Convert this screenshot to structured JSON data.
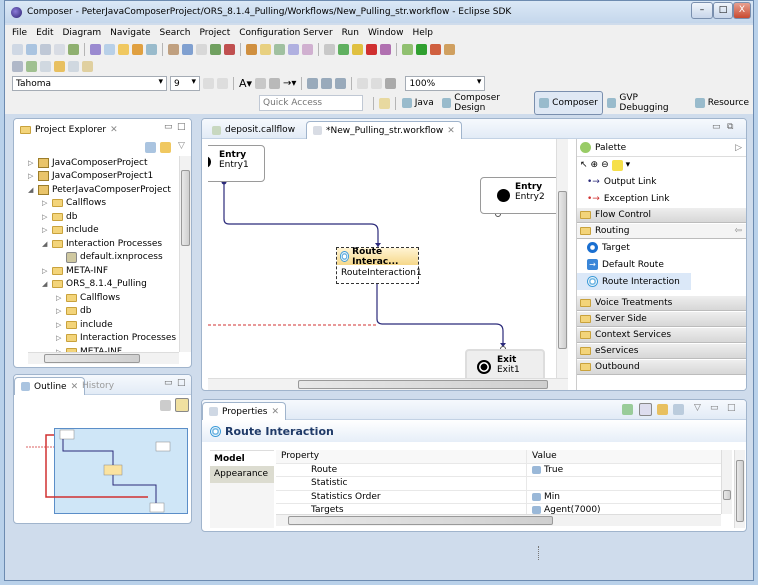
{
  "window": {
    "title": "Composer - PeterJavaComposerProject/ORS_8.1.4_Pulling/Workflows/New_Pulling_str.workflow - Eclipse SDK",
    "minimize": "–",
    "maximize": "□",
    "close": "X"
  },
  "menu": [
    "File",
    "Edit",
    "Diagram",
    "Navigate",
    "Search",
    "Project",
    "Configuration Server",
    "Run",
    "Window",
    "Help"
  ],
  "format_toolbar": {
    "font": "Tahoma",
    "size": "9",
    "zoom": "100%"
  },
  "quick_access": {
    "placeholder": "Quick Access"
  },
  "perspectives": [
    {
      "label": "Java",
      "active": false
    },
    {
      "label": "Composer Design",
      "active": false
    },
    {
      "label": "Composer",
      "active": true
    },
    {
      "label": "GVP Debugging",
      "active": false
    },
    {
      "label": "Resource",
      "active": false
    }
  ],
  "project_explorer": {
    "title": "Project Explorer",
    "items": [
      {
        "label": "JavaComposerProject",
        "depth": 0,
        "state": "collapsed",
        "type": "project"
      },
      {
        "label": "JavaComposerProject1",
        "depth": 0,
        "state": "collapsed",
        "type": "project"
      },
      {
        "label": "PeterJavaComposerProject",
        "depth": 0,
        "state": "expanded",
        "type": "project"
      },
      {
        "label": "Callflows",
        "depth": 1,
        "state": "collapsed",
        "type": "folder"
      },
      {
        "label": "db",
        "depth": 1,
        "state": "collapsed",
        "type": "folder"
      },
      {
        "label": "include",
        "depth": 1,
        "state": "collapsed",
        "type": "folder"
      },
      {
        "label": "Interaction Processes",
        "depth": 1,
        "state": "expanded",
        "type": "folder"
      },
      {
        "label": "default.ixnprocess",
        "depth": 2,
        "state": "leaf",
        "type": "file"
      },
      {
        "label": "META-INF",
        "depth": 1,
        "state": "collapsed",
        "type": "folder"
      },
      {
        "label": "ORS_8.1.4_Pulling",
        "depth": 1,
        "state": "expanded",
        "type": "folder"
      },
      {
        "label": "Callflows",
        "depth": 2,
        "state": "collapsed",
        "type": "folder"
      },
      {
        "label": "db",
        "depth": 2,
        "state": "collapsed",
        "type": "folder"
      },
      {
        "label": "include",
        "depth": 2,
        "state": "collapsed",
        "type": "folder"
      },
      {
        "label": "Interaction Processes",
        "depth": 2,
        "state": "collapsed",
        "type": "folder"
      },
      {
        "label": "META-INF",
        "depth": 2,
        "state": "collapsed",
        "type": "folder"
      }
    ]
  },
  "outline": {
    "tabs": [
      "Outline",
      "History"
    ]
  },
  "editor": {
    "tabs": [
      {
        "label": "deposit.callflow",
        "active": false
      },
      {
        "label": "*New_Pulling_str.workflow",
        "active": true
      }
    ],
    "nodes": {
      "entry1": {
        "type": "Entry",
        "name": "Entry1"
      },
      "entry2": {
        "type": "Entry",
        "name": "Entry2"
      },
      "route": {
        "type": "Route Interac...",
        "name": "RouteInteraction1"
      },
      "exit": {
        "type": "Exit",
        "name": "Exit1"
      }
    }
  },
  "palette": {
    "title": "Palette",
    "links": [
      "Output Link",
      "Exception Link"
    ],
    "drawers_top": [
      "Flow Control"
    ],
    "routing": {
      "label": "Routing",
      "items": [
        "Target",
        "Default Route",
        "Route Interaction"
      ]
    },
    "drawers_bottom": [
      "Voice Treatments",
      "Server Side",
      "Context Services",
      "eServices",
      "Outbound"
    ]
  },
  "properties": {
    "tab": "Properties",
    "heading": "Route Interaction",
    "sections": [
      "Model",
      "Appearance"
    ],
    "columns": [
      "Property",
      "Value"
    ],
    "rows": [
      {
        "property": "Route",
        "value": "True"
      },
      {
        "property": "Statistic",
        "value": ""
      },
      {
        "property": "Statistics Order",
        "value": "Min"
      },
      {
        "property": "Targets",
        "value": "Agent(7000)"
      }
    ]
  },
  "colors": {
    "link": "#2b2a7a",
    "exception_link": "#d03030",
    "selection": "#fbe3a0"
  }
}
